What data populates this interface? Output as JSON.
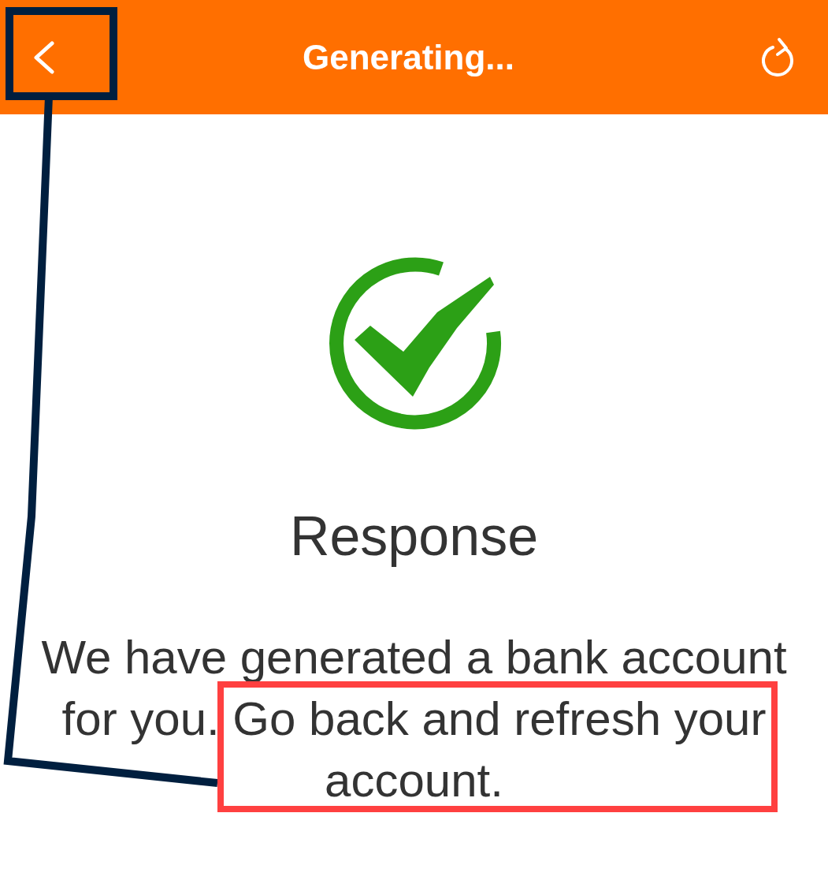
{
  "header": {
    "title": "Generating..."
  },
  "result": {
    "heading": "Response",
    "message": "We have generated a bank account for you. Go back and refresh your account."
  },
  "annotations": [
    {
      "kind": "box",
      "color": "#001f3f"
    },
    {
      "kind": "leader",
      "color": "#001f3f"
    },
    {
      "kind": "box",
      "color": "#ff4040"
    }
  ]
}
